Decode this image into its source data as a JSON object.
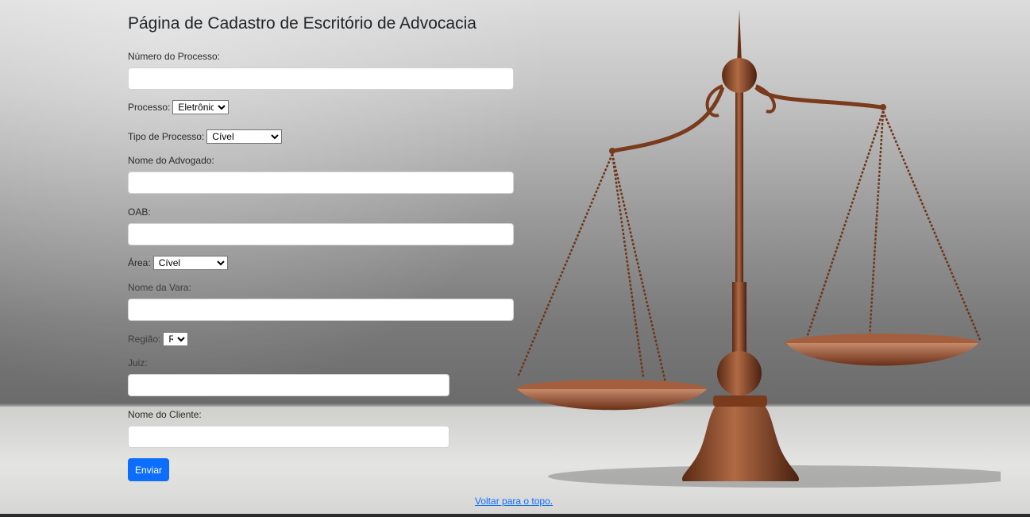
{
  "page": {
    "title": "Página de Cadastro de Escritório de Advocacia"
  },
  "form": {
    "numero_processo": {
      "label": "Número do Processo:",
      "value": ""
    },
    "processo": {
      "label": "Processo:",
      "selected": "Eletrônico"
    },
    "tipo_processo": {
      "label": "Tipo de Processo:",
      "selected": "Cível"
    },
    "nome_advogado": {
      "label": "Nome do Advogado:",
      "value": ""
    },
    "oab": {
      "label": "OAB:",
      "value": ""
    },
    "area": {
      "label": "Área:",
      "selected": "Cível"
    },
    "nome_vara": {
      "label": "Nome da Vara:",
      "value": ""
    },
    "regiao": {
      "label": "Região:",
      "selected": "RS"
    },
    "juiz": {
      "label": "Juiz:",
      "value": ""
    },
    "nome_cliente": {
      "label": "Nome do Cliente:",
      "value": ""
    },
    "submit_label": "Enviar"
  },
  "footer": {
    "back_to_top": "Voltar para o topo."
  },
  "colors": {
    "primary": "#0d6efd",
    "bronze": "#8a4a2a"
  },
  "background_image": {
    "icon": "scales-of-justice-icon"
  }
}
